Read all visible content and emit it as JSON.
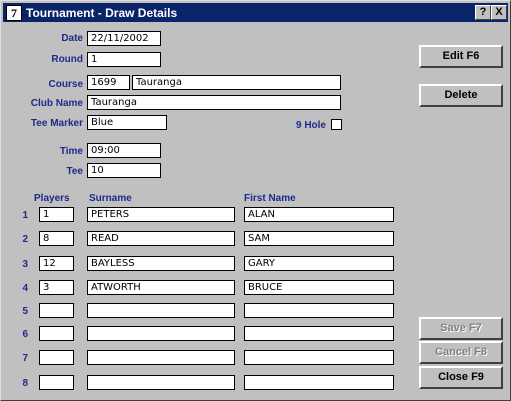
{
  "window": {
    "icon_glyph": "7",
    "title": "Tournament - Draw Details",
    "help_btn": "?",
    "close_btn": "X"
  },
  "form": {
    "date_label": "Date",
    "date": "22/11/2002",
    "round_label": "Round",
    "round": "1",
    "course_label": "Course",
    "course_code": "1699",
    "course_name": "Tauranga",
    "club_label": "Club Name",
    "club": "Tauranga",
    "tee_marker_label": "Tee Marker",
    "tee_marker": "Blue",
    "nine_hole_label": "9 Hole",
    "time_label": "Time",
    "time": "09:00",
    "tee_label": "Tee",
    "tee": "10"
  },
  "players": {
    "col_players": "Players",
    "col_surname": "Surname",
    "col_firstname": "First Name",
    "rows": [
      {
        "num": "1",
        "player": "1",
        "surname": "PETERS",
        "first": "ALAN"
      },
      {
        "num": "2",
        "player": "8",
        "surname": "READ",
        "first": "SAM"
      },
      {
        "num": "3",
        "player": "12",
        "surname": "BAYLESS",
        "first": "GARY"
      },
      {
        "num": "4",
        "player": "3",
        "surname": "ATWORTH",
        "first": "BRUCE"
      },
      {
        "num": "5",
        "player": "",
        "surname": "",
        "first": ""
      },
      {
        "num": "6",
        "player": "",
        "surname": "",
        "first": ""
      },
      {
        "num": "7",
        "player": "",
        "surname": "",
        "first": ""
      },
      {
        "num": "8",
        "player": "",
        "surname": "",
        "first": ""
      }
    ]
  },
  "buttons": {
    "edit": "Edit F6",
    "delete": "Delete",
    "save": "Save F7",
    "cancel": "Cancel F8",
    "close": "Close F9"
  }
}
